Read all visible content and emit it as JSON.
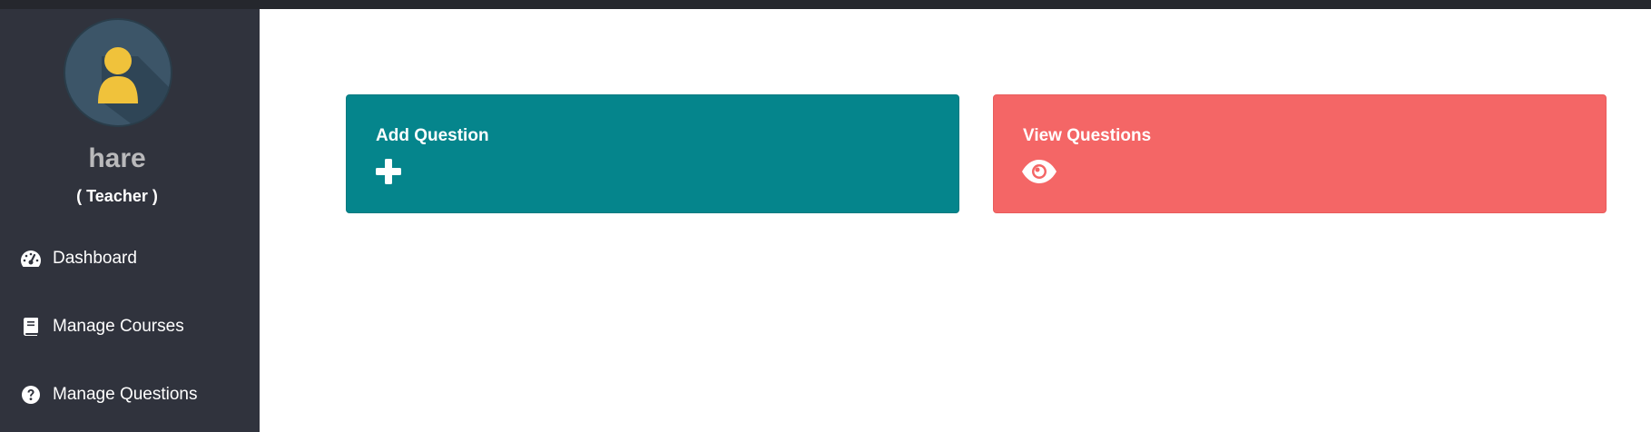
{
  "sidebar": {
    "user": {
      "name": "hare",
      "role": "( Teacher )",
      "avatar_icon": "user-avatar-icon",
      "avatar_bg": "#3c5568",
      "avatar_figure_color": "#f0c23b"
    },
    "nav": [
      {
        "label": "Dashboard",
        "icon": "dashboard-gauge-icon"
      },
      {
        "label": "Manage Courses",
        "icon": "book-icon"
      },
      {
        "label": "Manage Questions",
        "icon": "question-circle-icon"
      }
    ],
    "background": "#30333d"
  },
  "cards": [
    {
      "title": "Add Question",
      "icon": "plus-icon",
      "color": "#05858c"
    },
    {
      "title": "View Questions",
      "icon": "eye-icon",
      "color": "#f46666"
    }
  ]
}
